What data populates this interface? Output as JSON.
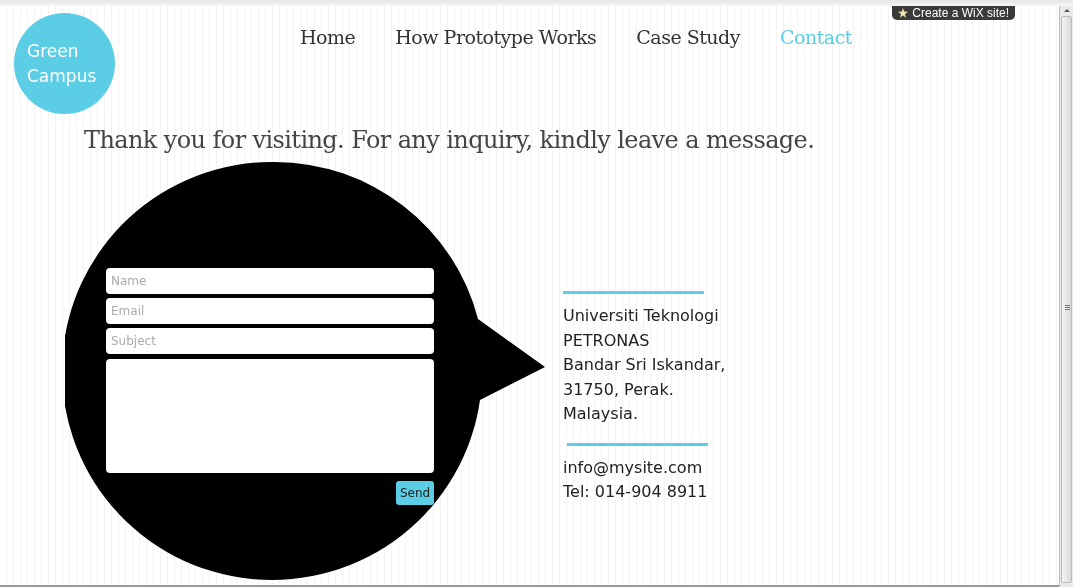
{
  "logo": {
    "lines": [
      "Green",
      "Campus"
    ]
  },
  "nav": [
    {
      "label": "Home",
      "selected": false
    },
    {
      "label": "How Prototype Works",
      "selected": false
    },
    {
      "label": "Case Study",
      "selected": false
    },
    {
      "label": "Contact",
      "selected": true
    }
  ],
  "wix_badge": {
    "label": "Create a WiX site!"
  },
  "heading": "Thank you for visiting. For any inquiry, kindly leave a message.",
  "form": {
    "fields": [
      {
        "kind": "text",
        "placeholder": "Name"
      },
      {
        "kind": "text",
        "placeholder": "Email"
      },
      {
        "kind": "text",
        "placeholder": "Subject"
      },
      {
        "kind": "textarea"
      }
    ],
    "button": "Send"
  },
  "address": [
    "Universiti Teknologi",
    "PETRONAS",
    "Bandar Sri Iskandar,",
    "31750, Perak.",
    "Malaysia."
  ],
  "contact": [
    "info@mysite.com",
    "Tel: 014-904 8911"
  ]
}
